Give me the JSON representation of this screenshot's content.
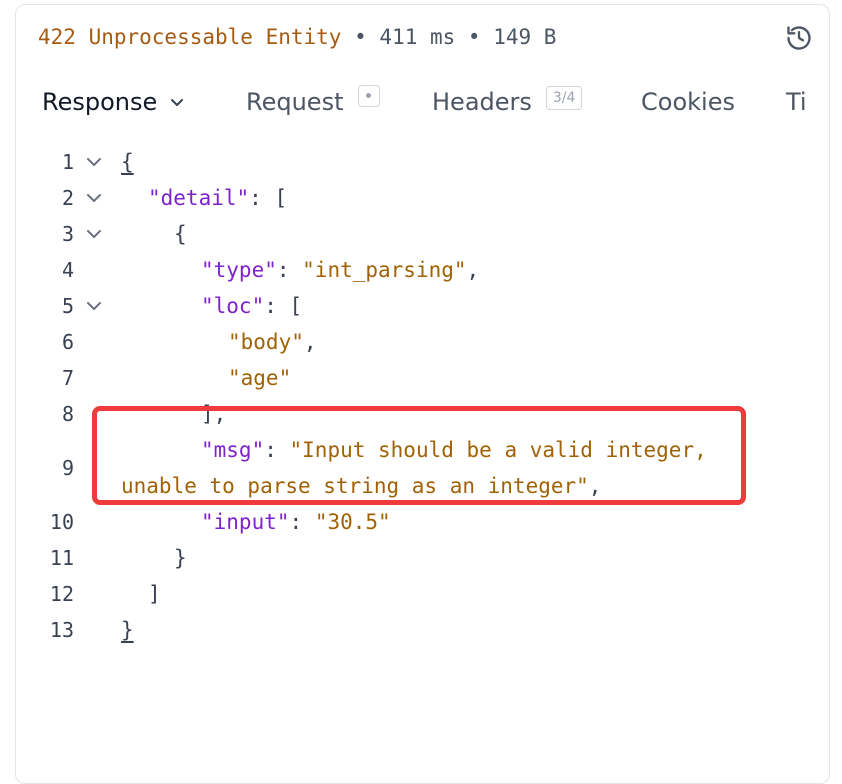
{
  "status": {
    "code_text": "422 Unprocessable Entity",
    "separator": "•",
    "time": "411 ms",
    "size": "149 B"
  },
  "tabs": {
    "response": "Response",
    "request": "Request",
    "headers": "Headers",
    "headers_badge": "3/4",
    "cookies": "Cookies",
    "timeline": "Ti"
  },
  "code_lines": {
    "l1": {
      "num": "1",
      "t1": "{"
    },
    "l2": {
      "num": "2",
      "k": "\"detail\"",
      "p": ": ["
    },
    "l3": {
      "num": "3",
      "t1": "{"
    },
    "l4": {
      "num": "4",
      "k": "\"type\"",
      "p": ": ",
      "s": "\"int_parsing\"",
      "e": ","
    },
    "l5": {
      "num": "5",
      "k": "\"loc\"",
      "p": ": ["
    },
    "l6": {
      "num": "6",
      "s": "\"body\"",
      "e": ","
    },
    "l7": {
      "num": "7",
      "s": "\"age\""
    },
    "l8": {
      "num": "8",
      "t1": "],"
    },
    "l9": {
      "num": "9",
      "k": "\"msg\"",
      "p": ": ",
      "s1": "\"Input should be a valid integer,",
      "s2": "unable to parse string as an integer\"",
      "e": ","
    },
    "l10": {
      "num": "10",
      "k": "\"input\"",
      "p": ": ",
      "s": "\"30.5\""
    },
    "l11": {
      "num": "11",
      "t1": "}"
    },
    "l12": {
      "num": "12",
      "t1": "]"
    },
    "l13": {
      "num": "13",
      "t1": "}"
    }
  },
  "colors": {
    "status_code": "#a75a12",
    "json_key": "#7e22ce",
    "json_string": "#a16207",
    "highlight_border": "#ef3b3b"
  },
  "icons": {
    "history": "history-icon",
    "fold": "chevron-down-icon"
  }
}
